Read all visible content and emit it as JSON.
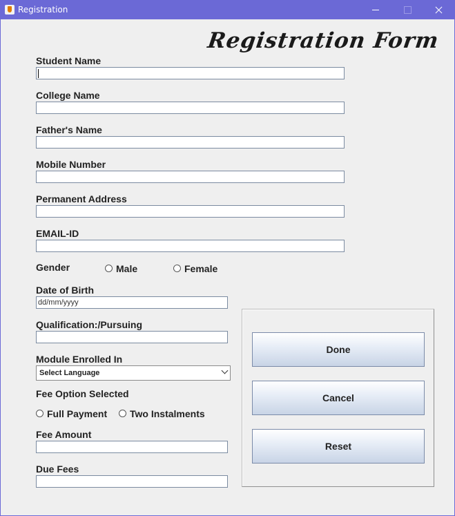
{
  "window": {
    "title": "Registration"
  },
  "form": {
    "title": "Registration Form",
    "fields": {
      "student_name": {
        "label": "Student Name",
        "value": ""
      },
      "college_name": {
        "label": "College Name",
        "value": ""
      },
      "fathers_name": {
        "label": "Father's Name",
        "value": ""
      },
      "mobile_number": {
        "label": "Mobile Number",
        "value": ""
      },
      "permanent_address": {
        "label": "Permanent Address",
        "value": ""
      },
      "email_id": {
        "label": "EMAIL-ID",
        "value": ""
      },
      "date_of_birth": {
        "label": "Date of Birth",
        "value": "dd/mm/yyyy"
      },
      "qualification": {
        "label": "Qualification:/Pursuing",
        "value": ""
      },
      "fee_amount": {
        "label": "Fee Amount",
        "value": ""
      },
      "due_fees": {
        "label": "Due Fees",
        "value": ""
      }
    },
    "gender": {
      "label": "Gender",
      "options": [
        "Male",
        "Female"
      ]
    },
    "module": {
      "label": "Module Enrolled In",
      "selected": "Select Language"
    },
    "fee_option": {
      "label": "Fee Option Selected",
      "options": [
        "Full Payment",
        "Two Instalments"
      ]
    }
  },
  "buttons": {
    "done": "Done",
    "cancel": "Cancel",
    "reset": "Reset"
  },
  "icons": {
    "app": "java-icon",
    "minimize": "minimize-icon",
    "maximize": "maximize-icon",
    "close": "close-icon"
  },
  "colors": {
    "titlebar": "#6b69d6",
    "background": "#efefef"
  }
}
